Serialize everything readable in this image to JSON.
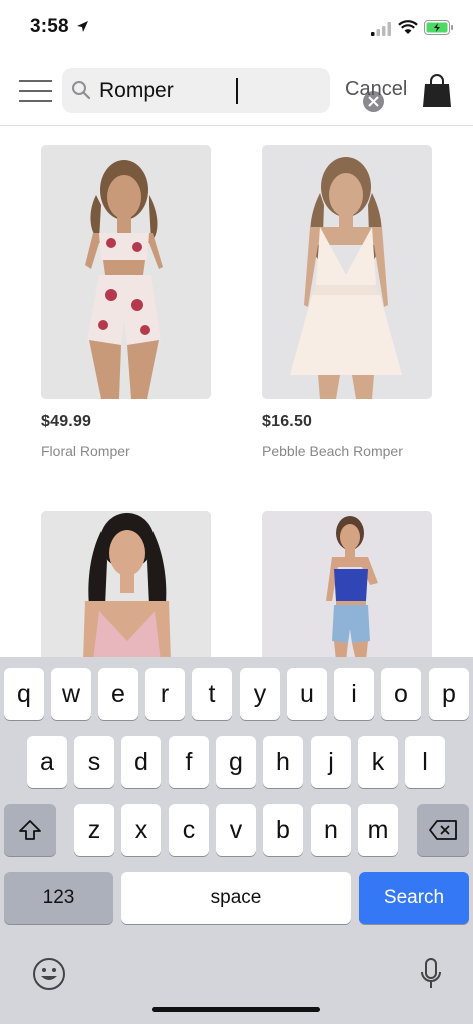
{
  "status_bar": {
    "time": "3:58"
  },
  "header": {
    "search_value": "Romper",
    "cancel_label": "Cancel"
  },
  "products": [
    {
      "price": "$49.99",
      "name": "Floral Romper"
    },
    {
      "price": "$16.50",
      "name": "Pebble Beach Romper"
    },
    {
      "price": "",
      "name": ""
    },
    {
      "price": "",
      "name": ""
    }
  ],
  "keyboard": {
    "row1": [
      "q",
      "w",
      "e",
      "r",
      "t",
      "y",
      "u",
      "i",
      "o",
      "p"
    ],
    "row2": [
      "a",
      "s",
      "d",
      "f",
      "g",
      "h",
      "j",
      "k",
      "l"
    ],
    "row3": [
      "z",
      "x",
      "c",
      "v",
      "b",
      "n",
      "m"
    ],
    "numbers_label": "123",
    "space_label": "space",
    "search_label": "Search"
  },
  "colors": {
    "accent": "#3478f6",
    "keyboard_bg": "#d3d5db",
    "battery": "#4cd964"
  }
}
